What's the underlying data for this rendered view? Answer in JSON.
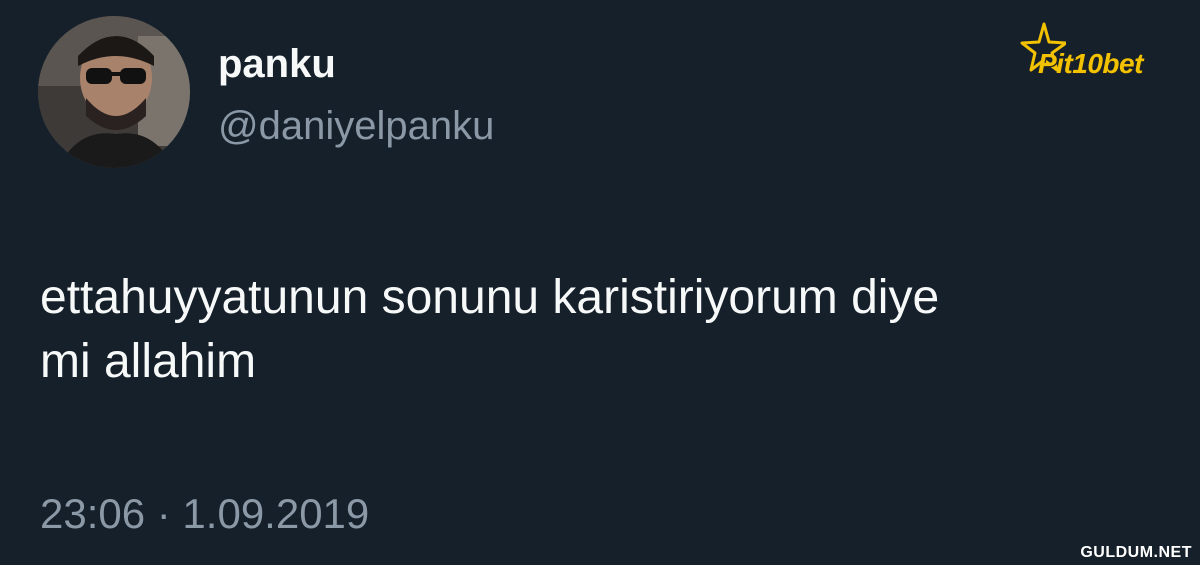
{
  "tweet": {
    "display_name": "panku",
    "handle": "@daniyelpanku",
    "text_line1": "ettahuyyatunun sonunu karistiriyorum diye",
    "text_line2": "mi allahim",
    "timestamp": "23:06 · 1.09.2019"
  },
  "avatar": {
    "icon": "user-avatar-photo"
  },
  "brand": {
    "logo_text": "Pit10bet",
    "icon": "star-icon"
  },
  "watermark": {
    "text": "GULDUM.NET"
  },
  "colors": {
    "background": "#15202b",
    "primary_text": "#f7f9f9",
    "secondary_text": "#8b98a5",
    "brand_gold": "#f2c200"
  }
}
